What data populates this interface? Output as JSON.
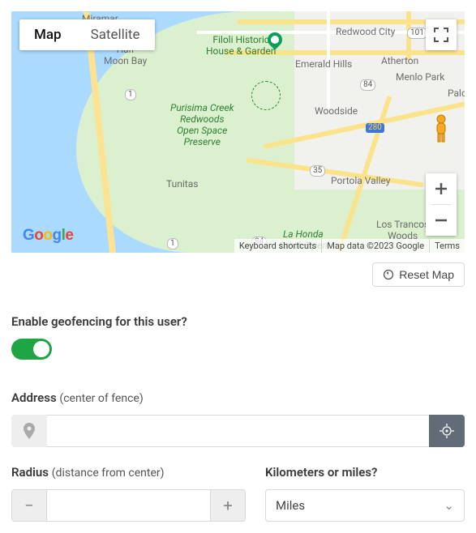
{
  "map": {
    "type_buttons": {
      "map": "Map",
      "satellite": "Satellite"
    },
    "labels": {
      "miramar": "Miramar",
      "half_moon_bay": "Half\nMoon Bay",
      "purisima": "Purisima Creek\nRedwoods\nOpen Space\nPreserve",
      "tunitas": "Tunitas",
      "la_honda": "La Honda\nCreek Open",
      "redwood_city": "Redwood City",
      "emerald_hills": "Emerald Hills",
      "atherton": "Atherton",
      "menlo_park": "Menlo Park",
      "palo_a": "Palo A",
      "woodside": "Woodside",
      "portola_valley": "Portola Valley",
      "los_trancos": "Los Trancos\nWoods",
      "filoli": "Filoli Historic\nHouse & Garden"
    },
    "shields": {
      "one_a": "1",
      "one_b": "1",
      "i280": "280",
      "r84_a": "84",
      "r84_b": "84",
      "r35": "35",
      "r101": "101"
    },
    "footer": {
      "shortcuts": "Keyboard shortcuts",
      "data": "Map data ©2023 Google",
      "terms": "Terms"
    },
    "logo": {
      "g1": "G",
      "o1": "o",
      "o2": "o",
      "g2": "g",
      "l": "l",
      "e": "e"
    }
  },
  "reset": {
    "label": "Reset Map"
  },
  "geofence": {
    "enable_label": "Enable geofencing for this user?",
    "enabled": true,
    "address_label": "Address",
    "address_sub": "(center of fence)",
    "address_value": "",
    "radius_label": "Radius",
    "radius_sub": "(distance from center)",
    "radius_value": "",
    "unit_label": "Kilometers or miles?",
    "unit_selected": "Miles"
  },
  "icons": {
    "plus": "+",
    "minus": "−",
    "chevron": "⌄"
  }
}
